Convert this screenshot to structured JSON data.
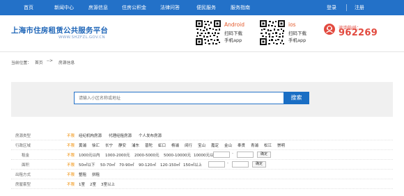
{
  "nav": {
    "items": [
      "首页",
      "新闻中心",
      "房源信息",
      "住房公积金",
      "法律问答",
      "便民服务",
      "服务指南"
    ],
    "login": "登录",
    "register": "注册"
  },
  "brand": {
    "title": "上海市住房租赁公共服务平台",
    "url": "WWW.SHZFZL.GOV.CN"
  },
  "apps": {
    "android": {
      "name": "Android",
      "line1": "扫码下载",
      "line2": "手机app"
    },
    "ios": {
      "name": "ios",
      "line1": "扫码下载",
      "line2": "手机app"
    }
  },
  "hotline": {
    "label": "咨询热线：",
    "number": "962269"
  },
  "breadcrumb": {
    "prefix": "当前位置：",
    "home": "首页",
    "arrow": "-->",
    "current": "房源信息"
  },
  "search": {
    "placeholder": "请输入小区名称或地址",
    "button": "搜索"
  },
  "filters": {
    "unlimited": "不限",
    "source": {
      "label": "房源类型",
      "options": [
        "经纪机构房源",
        "代理经租房源",
        "个人发布房源"
      ]
    },
    "district": {
      "label": "行政区域",
      "options": [
        "黄浦",
        "徐汇",
        "长宁",
        "静安",
        "浦东",
        "普陀",
        "虹口",
        "杨浦",
        "闵行",
        "宝山",
        "嘉定",
        "金山",
        "奉贤",
        "青浦",
        "松江",
        "崇明"
      ]
    },
    "rent": {
      "label": "租金",
      "options": [
        "1000元以内",
        "1000-2000元",
        "2000-5000元",
        "5000-10000元",
        "10000元以上"
      ],
      "dash": "-",
      "confirm": "确定"
    },
    "area": {
      "label": "面积",
      "options": [
        "50㎡以下",
        "50-70㎡",
        "70-90㎡",
        "90-120㎡",
        "120-150㎡",
        "150㎡以上"
      ],
      "dash": "-",
      "confirm": "确定"
    },
    "rental_method": {
      "label": "出租方式",
      "options": [
        "整租",
        "拼租"
      ]
    },
    "layout": {
      "label": "房屋套型",
      "options": [
        "1室",
        "2室",
        "3室以上"
      ]
    }
  },
  "colors": {
    "primary": "#2371c8",
    "accent": "#f08c00",
    "hotline": "#e24a3f"
  }
}
